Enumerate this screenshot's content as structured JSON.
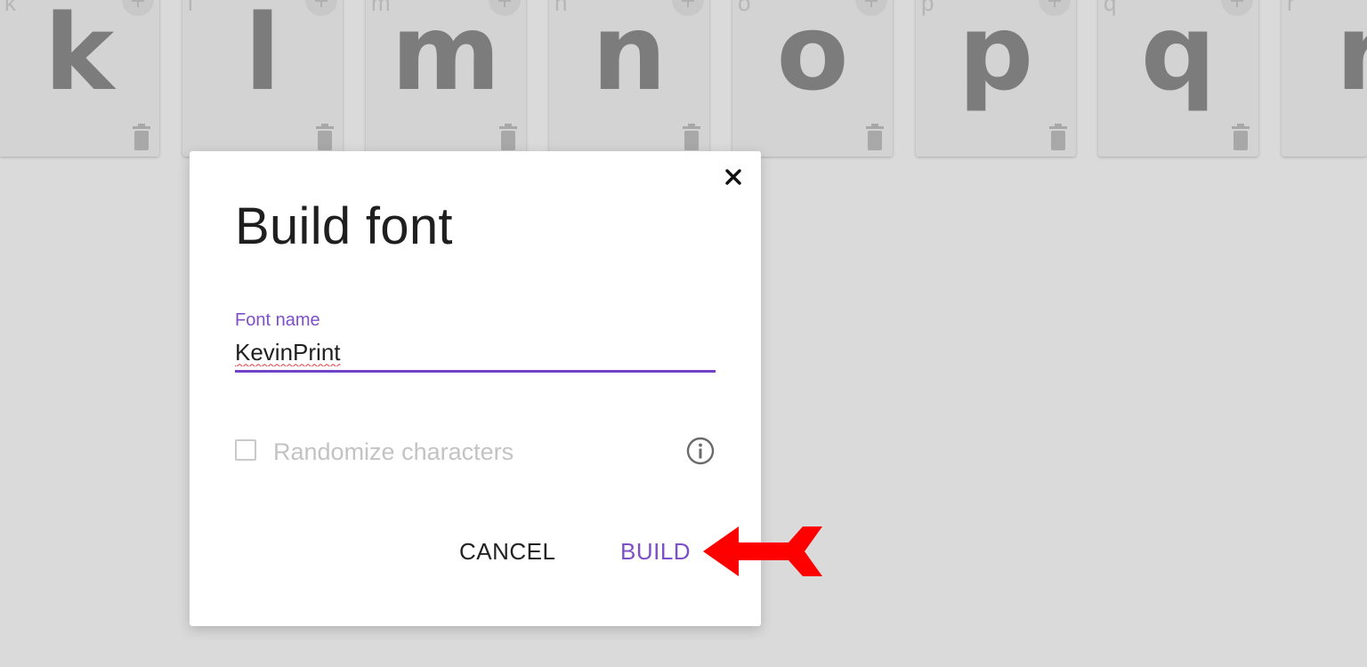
{
  "glyph_cards": [
    {
      "label": "k",
      "glyph": "k"
    },
    {
      "label": "l",
      "glyph": "l"
    },
    {
      "label": "m",
      "glyph": "m"
    },
    {
      "label": "n",
      "glyph": "n"
    },
    {
      "label": "o",
      "glyph": "o"
    },
    {
      "label": "p",
      "glyph": "p"
    },
    {
      "label": "q",
      "glyph": "q"
    },
    {
      "label": "r",
      "glyph": "r"
    }
  ],
  "icons": {
    "add": "plus-icon",
    "delete": "trash-icon",
    "close": "close-icon",
    "info": "info-icon",
    "annotation": "red-arrow"
  },
  "dialog": {
    "title": "Build font",
    "font_name": {
      "label": "Font name",
      "value": "KevinPrint"
    },
    "randomize": {
      "label": "Randomize characters",
      "checked": false
    },
    "cancel_label": "CANCEL",
    "build_label": "BUILD"
  },
  "colors": {
    "accent": "#7e4fc9",
    "underline": "#7343c7",
    "annotation": "#ff0000",
    "backdrop": "#dadada"
  }
}
